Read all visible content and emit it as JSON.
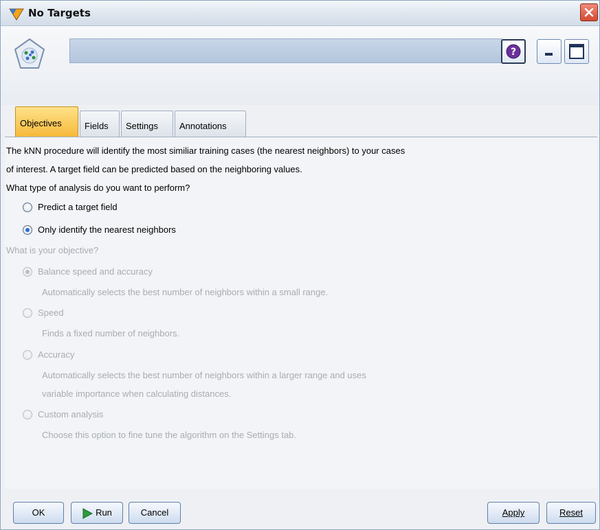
{
  "window": {
    "title": "No Targets"
  },
  "header": {
    "name_value": ""
  },
  "tabs": [
    {
      "label": "Objectives",
      "active": true
    },
    {
      "label": "Fields",
      "active": false
    },
    {
      "label": "Settings",
      "active": false
    },
    {
      "label": "Annotations",
      "active": false
    }
  ],
  "objectives": {
    "intro_line1": "The kNN procedure will identify the most similiar training cases (the nearest neighbors) to your cases",
    "intro_line2": "of interest. A target field can be predicted based on the neighboring values.",
    "analysis_question": "What type of analysis do you want to perform?",
    "analysis_options": [
      {
        "label": "Predict a target field",
        "selected": false
      },
      {
        "label": "Only identify the nearest neighbors",
        "selected": true
      }
    ],
    "objective_question": "What is your objective?",
    "objective_options": [
      {
        "label": "Balance speed and accuracy",
        "selected": true,
        "desc": [
          "Automatically selects the best number of neighbors within a small range."
        ]
      },
      {
        "label": "Speed",
        "selected": false,
        "desc": [
          "Finds a fixed number of neighbors."
        ]
      },
      {
        "label": "Accuracy",
        "selected": false,
        "desc": [
          "Automatically selects the best number of neighbors within a larger range and uses",
          "variable importance when calculating distances."
        ]
      },
      {
        "label": "Custom analysis",
        "selected": false,
        "desc": [
          "Choose this option to fine tune the algorithm on the Settings tab."
        ]
      }
    ]
  },
  "buttons": {
    "ok": "OK",
    "run": "Run",
    "cancel": "Cancel",
    "apply": "Apply",
    "reset": "Reset"
  },
  "colors": {
    "active_tab": "#f6b93a",
    "radio_selected": "#2b6fd6",
    "disabled_text": "#a8acb2",
    "run_arrow": "#2e9a3a"
  }
}
